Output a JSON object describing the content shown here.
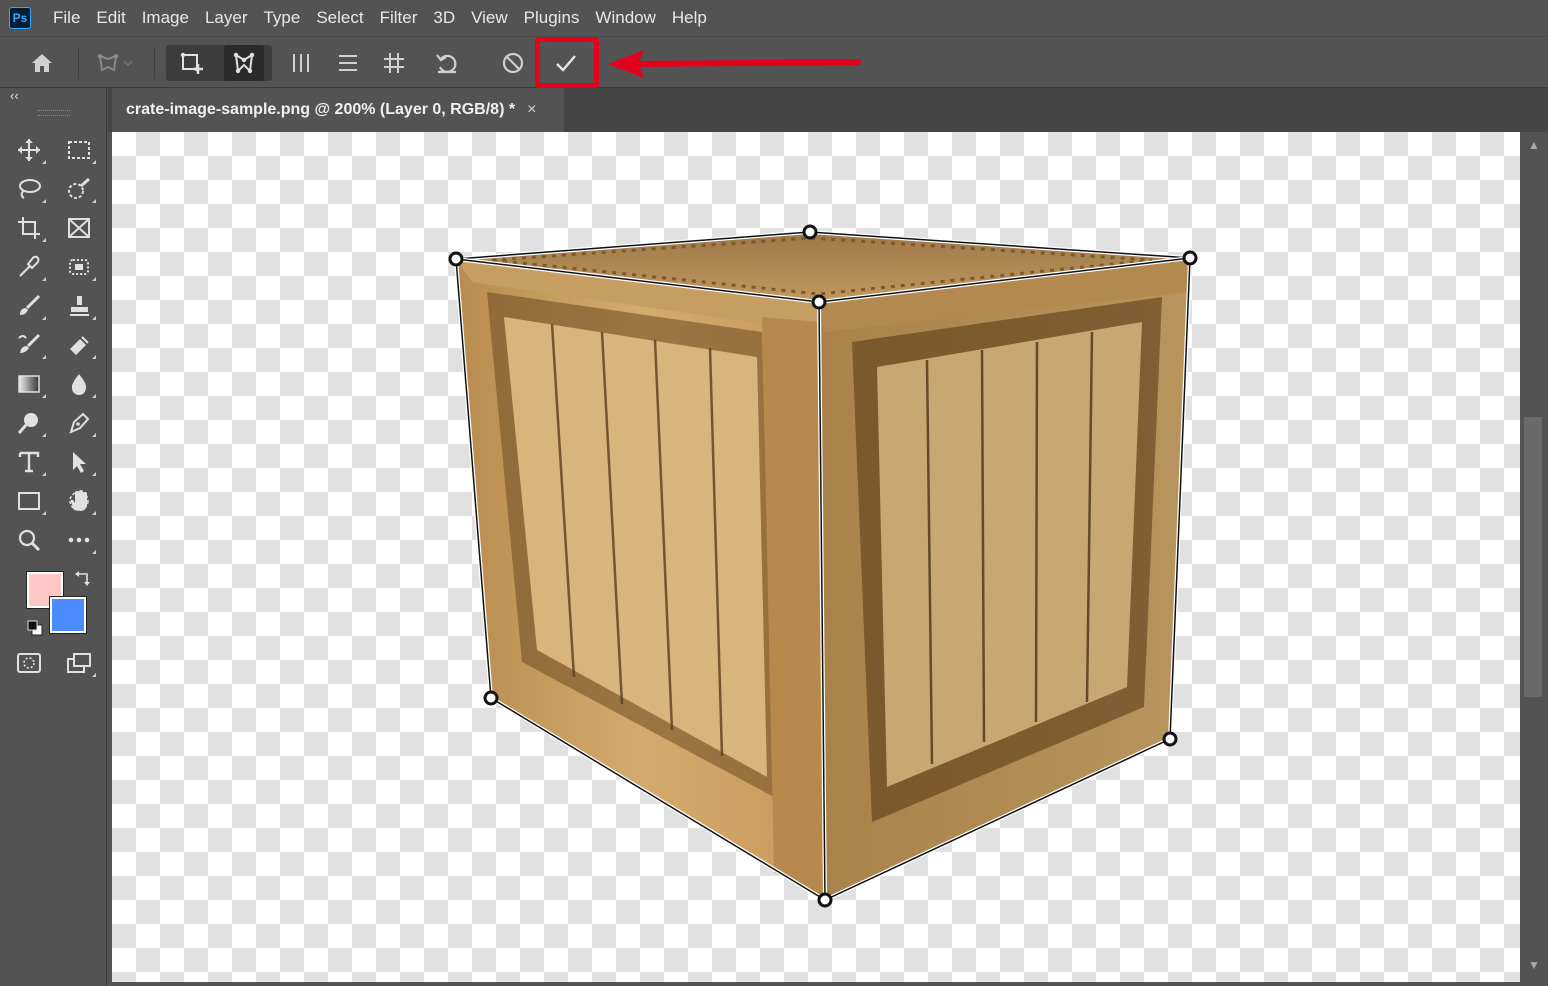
{
  "app": {
    "logo_text": "Ps"
  },
  "menu": [
    "File",
    "Edit",
    "Image",
    "Layer",
    "Type",
    "Select",
    "Filter",
    "3D",
    "View",
    "Plugins",
    "Window",
    "Help"
  ],
  "toolbar": {
    "collapse_glyph": "‹‹"
  },
  "document": {
    "tab_title": "crate-image-sample.png @ 200% (Layer 0, RGB/8) *",
    "close_glyph": "×"
  },
  "colors": {
    "foreground": "#ffc6c6",
    "background": "#4a8cff",
    "highlight": "#e3001b"
  },
  "options": {
    "icons": [
      "home-icon",
      "warp-mode-icon",
      "add-quad-icon",
      "warp-icon",
      "vertical-lines-icon",
      "horizontal-lines-icon",
      "grid-icon",
      "reset-icon",
      "cancel-icon",
      "commit-icon"
    ]
  },
  "tools": [
    "move-icon",
    "marquee-icon",
    "lasso-icon",
    "quick-select-icon",
    "crop-icon",
    "frame-icon",
    "eyedropper-icon",
    "healing-icon",
    "brush-icon",
    "stamp-icon",
    "history-brush-icon",
    "eraser-icon",
    "gradient-icon",
    "blur-icon",
    "dodge-icon",
    "pen-icon",
    "type-icon",
    "path-select-icon",
    "rectangle-icon",
    "hand-icon",
    "zoom-icon",
    "more-icon",
    "quick-mask-icon",
    "screen-mode-icon"
  ]
}
